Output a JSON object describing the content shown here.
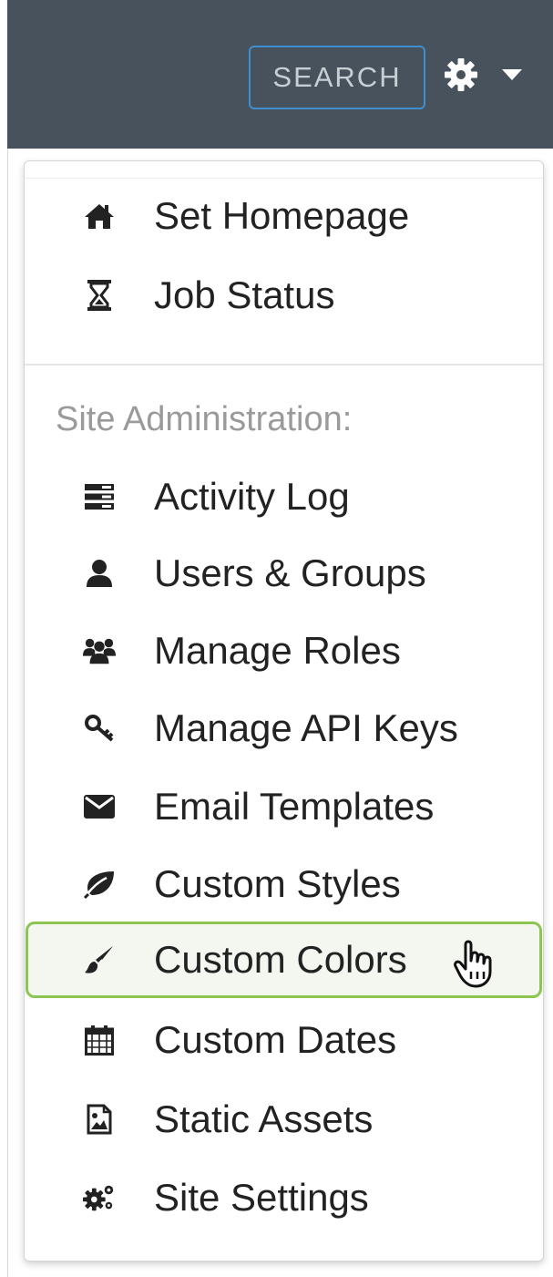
{
  "header": {
    "search_label": "SEARCH",
    "settings_icon": "gear-icon",
    "dropdown_icon": "caret-down-icon",
    "bg_color": "#47525c",
    "accent_color": "#3d8fd1"
  },
  "menu": {
    "top_items": [
      {
        "label": "Set Homepage",
        "icon": "home-icon"
      },
      {
        "label": "Job Status",
        "icon": "hourglass-icon"
      }
    ],
    "section_heading": "Site Administration:",
    "admin_items": [
      {
        "label": "Activity Log",
        "icon": "server-log-icon"
      },
      {
        "label": "Users & Groups",
        "icon": "user-icon"
      },
      {
        "label": "Manage Roles",
        "icon": "users-icon"
      },
      {
        "label": "Manage API Keys",
        "icon": "key-icon"
      },
      {
        "label": "Email Templates",
        "icon": "envelope-icon"
      },
      {
        "label": "Custom Styles",
        "icon": "leaf-icon"
      },
      {
        "label": "Custom Colors",
        "icon": "paintbrush-icon"
      },
      {
        "label": "Custom Dates",
        "icon": "calendar-icon"
      },
      {
        "label": "Static Assets",
        "icon": "image-file-icon"
      },
      {
        "label": "Site Settings",
        "icon": "cogs-icon"
      }
    ],
    "hovered_item": "Custom Colors",
    "highlight_color": "#8dc553"
  }
}
